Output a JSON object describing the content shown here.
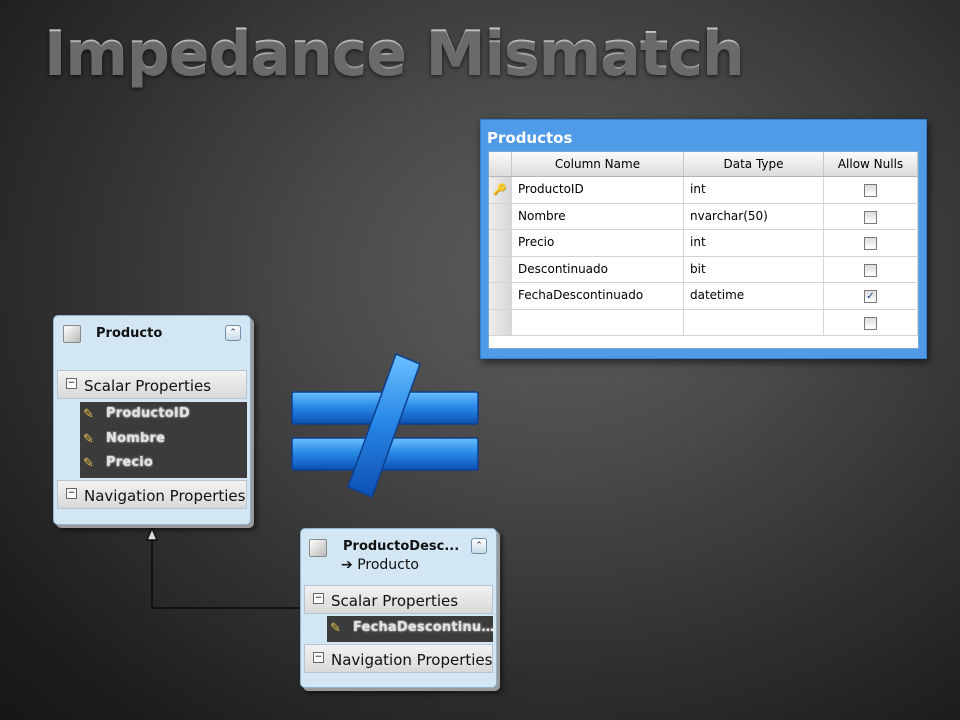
{
  "slide": {
    "title": "Impedance Mismatch"
  },
  "table": {
    "name": "Productos",
    "columns": [
      "Column Name",
      "Data Type",
      "Allow Nulls"
    ],
    "rows": [
      {
        "column": "ProductoID",
        "type": "int",
        "allow_nulls": false,
        "primary_key": true
      },
      {
        "column": "Nombre",
        "type": "nvarchar(50)",
        "allow_nulls": false,
        "primary_key": false
      },
      {
        "column": "Precio",
        "type": "int",
        "allow_nulls": false,
        "primary_key": false
      },
      {
        "column": "Descontinuado",
        "type": "bit",
        "allow_nulls": false,
        "primary_key": false
      },
      {
        "column": "FechaDescontinuado",
        "type": "datetime",
        "allow_nulls": true,
        "primary_key": false
      },
      {
        "column": "",
        "type": "",
        "allow_nulls": false,
        "primary_key": false
      }
    ]
  },
  "entity_producto": {
    "name": "Producto",
    "collapse_glyph": "⌃",
    "scalar_section": "Scalar Properties",
    "properties": [
      "ProductoID",
      "Nombre",
      "Precio"
    ],
    "navigation_section": "Navigation Properties"
  },
  "entity_descontinuado": {
    "name": "ProductoDesc...",
    "base_type": "Producto",
    "base_arrow": "➔",
    "collapse_glyph": "⌃",
    "scalar_section": "Scalar Properties",
    "properties": [
      "FechaDescontinuado..."
    ],
    "navigation_section": "Navigation Properties"
  },
  "symbols": {
    "collapse_minus": "−",
    "checkmark": "✓",
    "key_icon": "key-icon",
    "property_icon": "property-icon",
    "not_equal": "not-equal-icon"
  },
  "colors": {
    "table_border_blue": "#4f9be8",
    "entity_fill": "#d3e6f3",
    "not_equal_blue": "#2a8ae8"
  }
}
